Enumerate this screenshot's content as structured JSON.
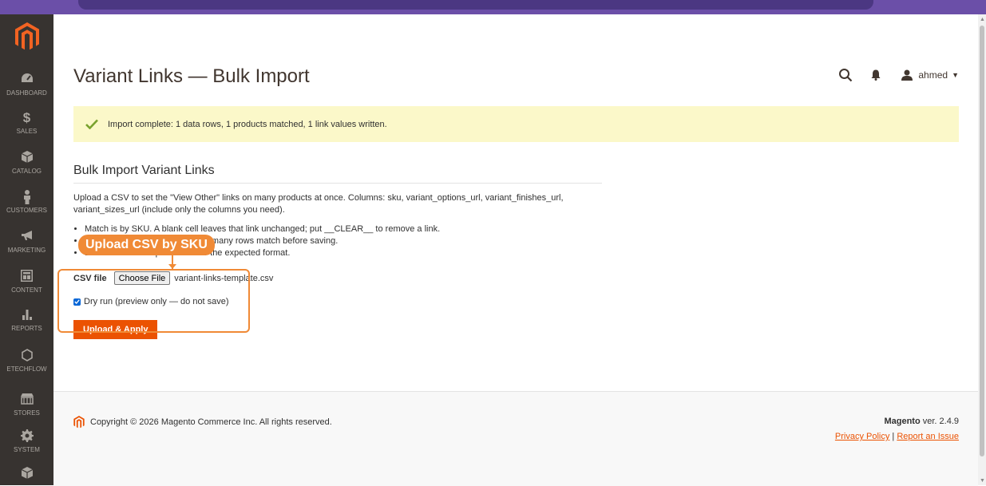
{
  "sidebar": {
    "items": [
      {
        "icon": "dashboard-icon",
        "label": "DASHBOARD"
      },
      {
        "icon": "dollar-icon",
        "label": "SALES"
      },
      {
        "icon": "cube-icon",
        "label": "CATALOG"
      },
      {
        "icon": "person-icon",
        "label": "CUSTOMERS"
      },
      {
        "icon": "megaphone-icon",
        "label": "MARKETING"
      },
      {
        "icon": "layout-icon",
        "label": "CONTENT"
      },
      {
        "icon": "bar-chart-icon",
        "label": "REPORTS"
      },
      {
        "icon": "hexagon-icon",
        "label": "ETECHFLOW"
      },
      {
        "icon": "store-icon",
        "label": "STORES"
      },
      {
        "icon": "gear-icon",
        "label": "SYSTEM"
      }
    ]
  },
  "header": {
    "title": "Variant Links — Bulk Import",
    "username": "ahmed"
  },
  "message": {
    "text": "Import complete: 1 data rows, 1 products matched, 1 link values written."
  },
  "section": {
    "title": "Bulk Import Variant Links",
    "description": "Upload a CSV to set the \"View Other\" links on many products at once. Columns: sku, variant_options_url, variant_finishes_url, variant_sizes_url (include only the columns you need).",
    "bullets": [
      "Match is by SKU. A blank cell leaves that link unchanged; put __CLEAR__ to remove a link.",
      "Use Dry run first to preview how many rows match before saving.",
      "Download the template CSV for the expected format."
    ]
  },
  "form": {
    "csv_label": "CSV file",
    "choose_label": "Choose File",
    "file_name": "variant-links-template.csv",
    "dry_run_label": "Dry run (preview only — do not save)",
    "dry_run_checked": true,
    "submit_label": "Upload & Apply"
  },
  "annotation": {
    "label": "Upload CSV by SKU"
  },
  "footer": {
    "copyright": "Copyright © 2026 Magento Commerce Inc. All rights reserved.",
    "brand": "Magento",
    "version": " ver. 2.4.9",
    "privacy": "Privacy Policy",
    "separator": " | ",
    "report": "Report an Issue"
  },
  "colors": {
    "accent": "#eb5202",
    "sidebar": "#373330",
    "success_bg": "#fbf8c9",
    "annotation": "#f08a36"
  }
}
